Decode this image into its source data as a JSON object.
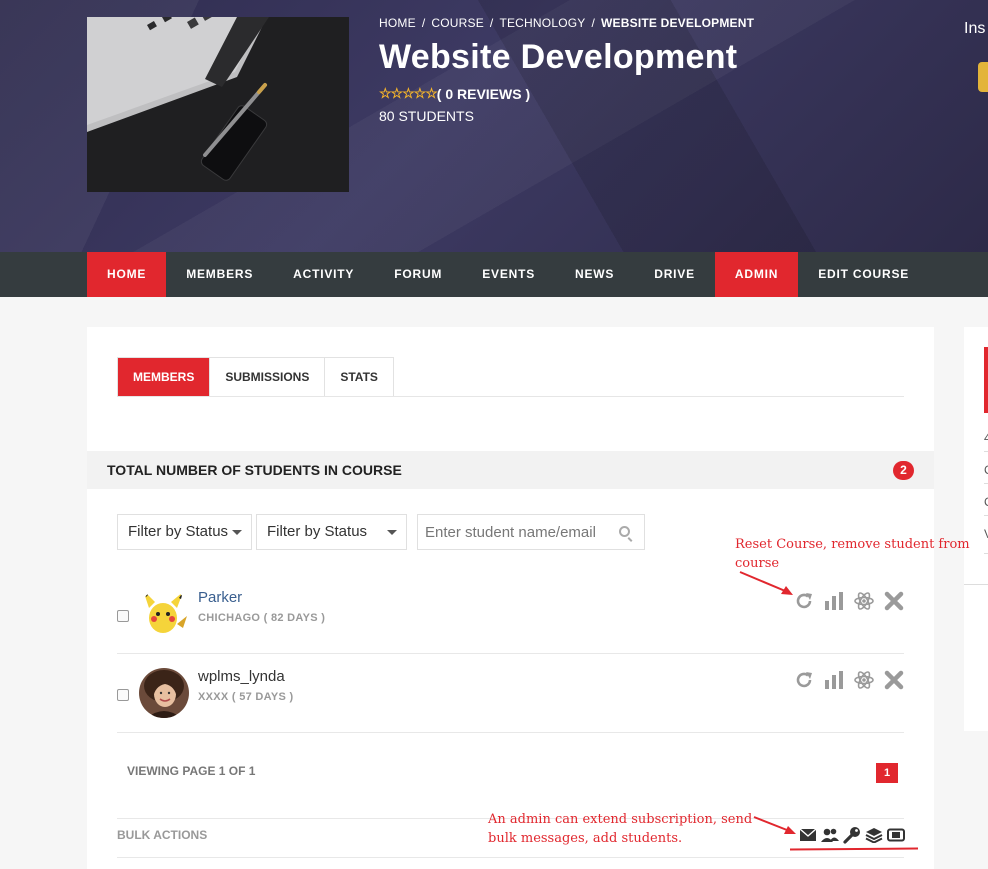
{
  "breadcrumb": {
    "home": "HOME",
    "course": "COURSE",
    "category": "TECHNOLOGY",
    "current": "WEBSITE DEVELOPMENT",
    "separator": "/"
  },
  "course": {
    "title": "Website Development",
    "stars": "☆☆☆☆☆",
    "reviews": "( 0 REVIEWS )",
    "students": "80 STUDENTS"
  },
  "hero_right_text": "Ins",
  "nav": {
    "items": [
      "HOME",
      "MEMBERS",
      "ACTIVITY",
      "FORUM",
      "EVENTS",
      "NEWS",
      "DRIVE",
      "ADMIN",
      "EDIT COURSE"
    ],
    "active": [
      "HOME",
      "ADMIN"
    ]
  },
  "tabs": {
    "members": "MEMBERS",
    "submissions": "SUBMISSIONS",
    "stats": "STATS",
    "active": "MEMBERS"
  },
  "count": {
    "title": "TOTAL NUMBER OF STUDENTS IN COURSE",
    "value": "2"
  },
  "filters": {
    "filter1": "Filter by Status",
    "filter2": "Filter by Status",
    "search_placeholder": "Enter student name/email"
  },
  "students": [
    {
      "name": "Parker",
      "meta": "CHICHAGO ( 82 DAYS )"
    },
    {
      "name": "wplms_lynda",
      "meta": "XXXX ( 57 DAYS )"
    }
  ],
  "pager": {
    "text": "VIEWING PAGE 1 OF 1",
    "page": "1"
  },
  "bulk": {
    "label": "BULK ACTIONS",
    "icons": [
      "envelope-icon",
      "users-icon",
      "key-icon",
      "layers-icon",
      "ticket-icon"
    ]
  },
  "side": {
    "items": [
      "4",
      "C",
      "C",
      "V"
    ]
  },
  "annotations": {
    "reset_line1": "Reset Course, remove student from",
    "reset_line2": "course",
    "admin_line1": "An admin can extend subscription, send",
    "admin_line2": "bulk messages, add students."
  },
  "colors": {
    "accent": "#e1272e",
    "nav_bg": "#353c3f",
    "hero_bg": "#35325a",
    "star": "#f5b42a",
    "link": "#3a5f8f"
  }
}
